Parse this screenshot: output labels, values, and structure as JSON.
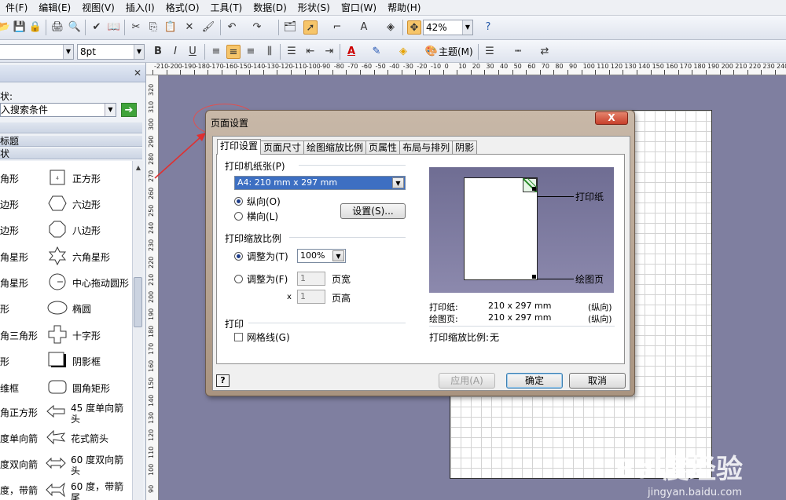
{
  "menu": {
    "items": [
      "件(F)",
      "编辑(E)",
      "视图(V)",
      "插入(I)",
      "格式(O)",
      "工具(T)",
      "数据(D)",
      "形状(S)",
      "窗口(W)",
      "帮助(H)"
    ]
  },
  "toolbar": {
    "zoom_value": "42%",
    "font_size_value": "8pt",
    "theme_label": "主题(M)"
  },
  "shapes_panel": {
    "shape_label": "状:",
    "search_placeholder": "入搜索条件",
    "go_symbol": "➔",
    "section_title": "标题",
    "section_shapes": "状",
    "items": [
      {
        "left": "角形",
        "right": "正方形"
      },
      {
        "left": "边形",
        "right": "六边形"
      },
      {
        "left": "边形",
        "right": "八边形"
      },
      {
        "left": "角星形",
        "right": "六角星形"
      },
      {
        "left": "角星形",
        "right": "中心拖动圆形"
      },
      {
        "left": "形",
        "right": "椭圆"
      },
      {
        "left": "角三角形",
        "right": "十字形"
      },
      {
        "left": "形",
        "right": "阴影框"
      },
      {
        "left": "维框",
        "right": "圆角矩形"
      },
      {
        "left": "角正方形",
        "right": "45 度单向箭头"
      },
      {
        "left": "度单向箭",
        "right": "花式箭头"
      },
      {
        "left": "度双向箭",
        "right": "60 度双向箭头"
      },
      {
        "left": "度，带箭",
        "right": "60 度，带箭尾"
      }
    ]
  },
  "ruler": {
    "top_labels": [
      "-210",
      "-200",
      "-190",
      "-180",
      "-170",
      "-160",
      "-150",
      "-140",
      "-130",
      "-120",
      "-110",
      "-100",
      "-90",
      "-80",
      "-70",
      "-60",
      "-50",
      "-40",
      "-30",
      "-20",
      "-10",
      "0",
      "10",
      "20",
      "30",
      "40",
      "50",
      "60",
      "70",
      "80",
      "90",
      "100",
      "110",
      "120",
      "130",
      "140",
      "150",
      "160",
      "170",
      "180",
      "190",
      "200",
      "210",
      "220",
      "230",
      "240"
    ],
    "left_labels": [
      "320",
      "310",
      "300",
      "290",
      "280",
      "270",
      "260",
      "250",
      "240",
      "230",
      "220",
      "210",
      "200",
      "190",
      "180",
      "170",
      "160",
      "150",
      "140",
      "130",
      "120",
      "110",
      "100",
      "90"
    ]
  },
  "dialog": {
    "title": "页面设置",
    "close_symbol": "X",
    "tabs": [
      "打印设置",
      "页面尺寸",
      "绘图缩放比例",
      "页属性",
      "布局与排列",
      "阴影"
    ],
    "paper_group_label": "打印机纸张(P)",
    "paper_value": "A4:  210 mm x 297 mm",
    "portrait_label": "纵向(O)",
    "landscape_label": "横向(L)",
    "setup_button": "设置(S)...",
    "zoom_group_label": "打印缩放比例",
    "adjust_to_label": "调整为(T)",
    "adjust_to_value": "100%",
    "fit_to_label": "调整为(F)",
    "fit_width_value": "1",
    "fit_height_value": "1",
    "x_label": "x",
    "pages_wide_label": "页宽",
    "pages_high_label": "页高",
    "print_group_label": "打印",
    "gridlines_label": "网格线(G)",
    "preview_printer_label": "打印纸",
    "preview_drawing_label": "绘图页",
    "info_printer_label": "打印纸:",
    "info_printer_size": "210 x 297 mm",
    "info_printer_orient": "(纵向)",
    "info_drawing_label": "绘图页:",
    "info_drawing_size": "210 x 297 mm",
    "info_drawing_orient": "(纵向)",
    "print_zoom_label": "打印缩放比例:",
    "print_zoom_value": "无",
    "help_symbol": "?",
    "apply_button": "应用(A)",
    "ok_button": "确定",
    "cancel_button": "取消"
  },
  "watermark": {
    "text": "Bai度经验",
    "sub": "jingyan.baidu.com"
  },
  "colors": {
    "canvas": "#7f7fa0",
    "annotation": "#e03030",
    "go_button": "#3fa33a"
  }
}
